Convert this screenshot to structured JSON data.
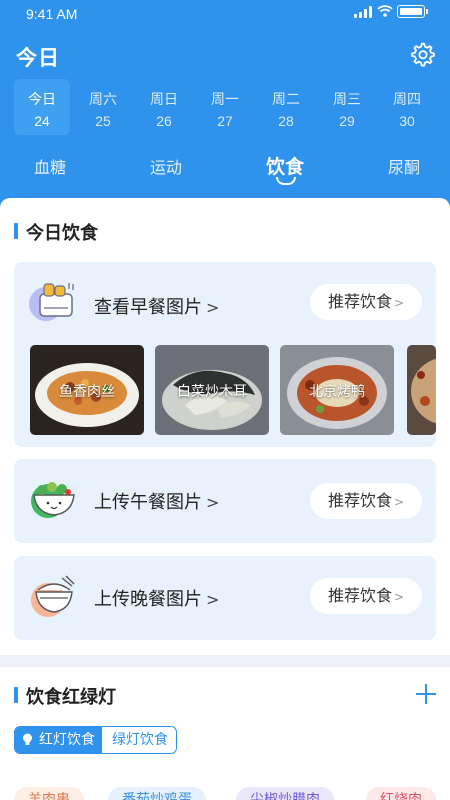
{
  "status_bar": {
    "time": "9:41 AM"
  },
  "header": {
    "title": "今日"
  },
  "week": [
    {
      "weekday": "今日",
      "date": "24",
      "active": true
    },
    {
      "weekday": "周六",
      "date": "25"
    },
    {
      "weekday": "周日",
      "date": "26"
    },
    {
      "weekday": "周一",
      "date": "27"
    },
    {
      "weekday": "周二",
      "date": "28"
    },
    {
      "weekday": "周三",
      "date": "29"
    },
    {
      "weekday": "周四",
      "date": "30"
    }
  ],
  "tabs": [
    {
      "label": "血糖"
    },
    {
      "label": "运动"
    },
    {
      "label": "饮食",
      "active": true
    },
    {
      "label": "尿酮"
    }
  ],
  "today_diet": {
    "title": "今日饮食",
    "meals": [
      {
        "label": "查看早餐图片",
        "recommend": "推荐饮食",
        "icon": "toaster-icon",
        "photos": [
          {
            "caption": "鱼香肉丝"
          },
          {
            "caption": "白菜炒木耳"
          },
          {
            "caption": "北京烤鸭"
          },
          {
            "caption": ""
          }
        ]
      },
      {
        "label": "上传午餐图片",
        "recommend": "推荐饮食",
        "icon": "salad-bowl-icon"
      },
      {
        "label": "上传晚餐图片",
        "recommend": "推荐饮食",
        "icon": "rice-bowl-icon"
      }
    ]
  },
  "traffic_light": {
    "title": "饮食红绿灯",
    "segments": {
      "red": "红灯饮食",
      "green": "绿灯饮食"
    },
    "chips": [
      "羊肉串",
      "番茄炒鸡蛋",
      "尖椒炒腊肉",
      "红烧肉"
    ]
  },
  "colors": {
    "primary": "#2f93ed",
    "card": "#e8f2fd"
  }
}
